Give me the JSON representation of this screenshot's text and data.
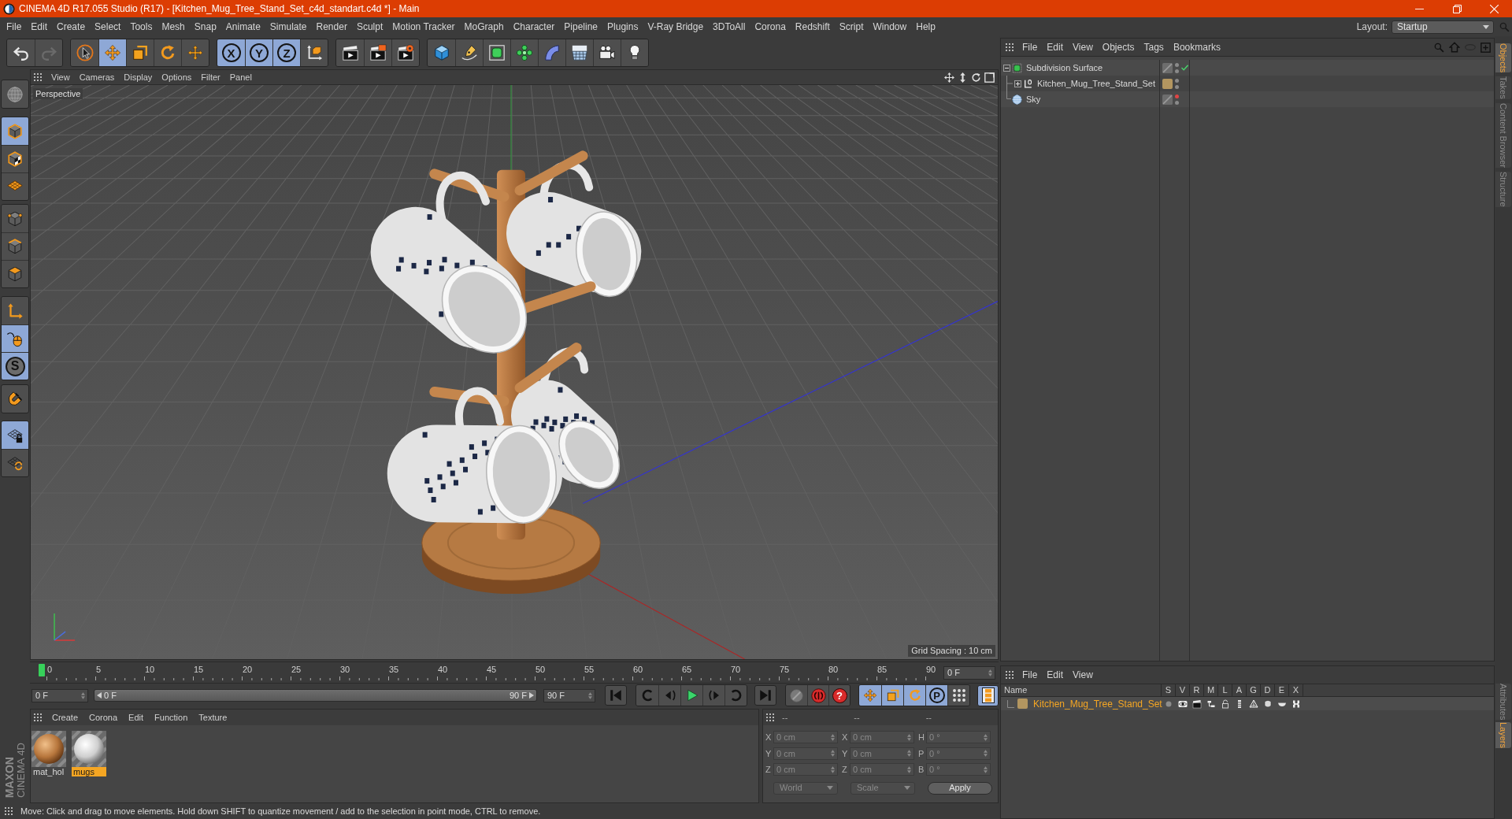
{
  "window": {
    "title": "CINEMA 4D R17.055 Studio (R17) - [Kitchen_Mug_Tree_Stand_Set_c4d_standart.c4d *] - Main"
  },
  "menu": [
    "File",
    "Edit",
    "Create",
    "Select",
    "Tools",
    "Mesh",
    "Snap",
    "Animate",
    "Simulate",
    "Render",
    "Sculpt",
    "Motion Tracker",
    "MoGraph",
    "Character",
    "Pipeline",
    "Plugins",
    "V-Ray Bridge",
    "3DToAll",
    "Corona",
    "Redshift",
    "Script",
    "Window",
    "Help"
  ],
  "layout": {
    "label": "Layout:",
    "value": "Startup"
  },
  "toolbar": [
    [
      {
        "kind": "undo",
        "disabled": false
      },
      {
        "kind": "redo",
        "disabled": true
      }
    ],
    [
      {
        "kind": "select",
        "selected": false
      },
      {
        "kind": "move",
        "selected": true
      },
      {
        "kind": "scale",
        "selected": false
      },
      {
        "kind": "rotate",
        "selected": false
      },
      {
        "kind": "recent",
        "selected": false
      }
    ],
    [
      {
        "kind": "axis",
        "label": "X",
        "selected": true
      },
      {
        "kind": "axis",
        "label": "Y",
        "selected": true
      },
      {
        "kind": "axis",
        "label": "Z",
        "selected": true
      },
      {
        "kind": "coords",
        "selected": false
      }
    ],
    [
      {
        "kind": "render_view"
      },
      {
        "kind": "render_viewer"
      },
      {
        "kind": "render_settings"
      }
    ],
    [
      {
        "kind": "cube"
      },
      {
        "kind": "pen"
      },
      {
        "kind": "subdivision"
      },
      {
        "kind": "cloner"
      },
      {
        "kind": "bend"
      },
      {
        "kind": "floor"
      },
      {
        "kind": "camera"
      },
      {
        "kind": "light"
      }
    ]
  ],
  "left_tools": [
    [
      {
        "kind": "make_editable"
      }
    ],
    [
      {
        "kind": "model",
        "selected": true
      },
      {
        "kind": "texture",
        "selected": false
      },
      {
        "kind": "workplane",
        "selected": false
      }
    ],
    [
      {
        "kind": "points",
        "selected": false
      },
      {
        "kind": "edges",
        "selected": false
      },
      {
        "kind": "polygons",
        "selected": false
      }
    ],
    [
      {
        "kind": "axis_mode",
        "selected": false
      },
      {
        "kind": "tweak",
        "selected": true
      },
      {
        "kind": "solo",
        "label": "S",
        "selected": true
      }
    ],
    [
      {
        "kind": "snap",
        "selected": false
      }
    ],
    [
      {
        "kind": "workplane_lock",
        "selected": true
      },
      {
        "kind": "workplane_rotate",
        "selected": false
      }
    ]
  ],
  "logo": {
    "brand": "MAXON",
    "product": "CINEMA 4D"
  },
  "viewport": {
    "menu": [
      "View",
      "Cameras",
      "Display",
      "Options",
      "Filter",
      "Panel"
    ],
    "camera": "Perspective",
    "grid_spacing": "Grid Spacing : 10 cm"
  },
  "timeline": {
    "ticks": [
      "0",
      "5",
      "10",
      "15",
      "20",
      "25",
      "30",
      "35",
      "40",
      "45",
      "50",
      "55",
      "60",
      "65",
      "70",
      "75",
      "80",
      "85",
      "90"
    ],
    "level": 0,
    "current": "0 F"
  },
  "transport": {
    "start": "0 F",
    "range": {
      "start": "0 F",
      "end": "90 F",
      "level": 1
    },
    "end": "90 F",
    "record_buttons": [
      {
        "kind": "keyframe"
      },
      {
        "kind": "record"
      },
      {
        "kind": "autokey",
        "label": "?"
      }
    ],
    "key_buttons": [
      {
        "kind": "move",
        "selected": true
      },
      {
        "kind": "scale",
        "selected": true
      },
      {
        "kind": "rotate",
        "selected": true
      },
      {
        "kind": "param",
        "label": "P",
        "selected": true
      },
      {
        "kind": "points",
        "selected": false
      }
    ],
    "timeline_button": {
      "selected": true
    }
  },
  "materials": {
    "menu": [
      "Create",
      "Corona",
      "Edit",
      "Function",
      "Texture"
    ],
    "items": [
      {
        "name": "mat_hol",
        "kind": "wood",
        "selected": false
      },
      {
        "name": "mugs",
        "kind": "ceramic",
        "selected": true
      }
    ]
  },
  "coordinates": {
    "disabled": true,
    "headers": [
      "--",
      "--",
      "--"
    ],
    "rows": [
      [
        {
          "label": "X",
          "value": "0 cm"
        },
        {
          "label": "X",
          "value": "0 cm"
        },
        {
          "label": "H",
          "value": "0 °"
        }
      ],
      [
        {
          "label": "Y",
          "value": "0 cm"
        },
        {
          "label": "Y",
          "value": "0 cm"
        },
        {
          "label": "P",
          "value": "0 °"
        }
      ],
      [
        {
          "label": "Z",
          "value": "0 cm"
        },
        {
          "label": "Z",
          "value": "0 cm"
        },
        {
          "label": "B",
          "value": "0 °"
        }
      ]
    ],
    "dropdowns": [
      "World",
      "Scale"
    ],
    "apply": "Apply"
  },
  "status_bar": "Move: Click and drag to move elements. Hold down SHIFT to quantize movement / add to the selection in point mode, CTRL to remove.",
  "objects": {
    "menu": [
      "File",
      "Edit",
      "View",
      "Objects",
      "Tags",
      "Bookmarks"
    ],
    "items": [
      {
        "name": "Subdivision Surface",
        "kind": "subdivision",
        "selected": false,
        "expanded": true,
        "checked": true,
        "editor_hidden": false,
        "children": [
          {
            "name": "Kitchen_Mug_Tree_Stand_Set",
            "kind": "null",
            "selected": false,
            "expanded": false,
            "checked": false,
            "editor_hidden": false,
            "color": "#b39660"
          }
        ]
      },
      {
        "name": "Sky",
        "kind": "sky",
        "selected": false,
        "checked": false,
        "editor_hidden": true
      }
    ]
  },
  "layers": {
    "menu": [
      "File",
      "Edit",
      "View"
    ],
    "columns": [
      "Name",
      "S",
      "V",
      "R",
      "M",
      "L",
      "A",
      "G",
      "D",
      "E",
      "X"
    ],
    "rows": [
      {
        "name": "Kitchen_Mug_Tree_Stand_Set",
        "color": "#b39660",
        "selected": true
      }
    ]
  },
  "side_tabs": [
    {
      "label": "Objects",
      "selected": true
    },
    {
      "label": "Takes",
      "selected": false
    },
    {
      "label": "Content Browser",
      "selected": false
    },
    {
      "label": "Structure",
      "selected": false
    }
  ],
  "side_tabs_lower": [
    {
      "label": "Attributes",
      "selected": false
    },
    {
      "label": "Layers",
      "selected": true
    }
  ]
}
